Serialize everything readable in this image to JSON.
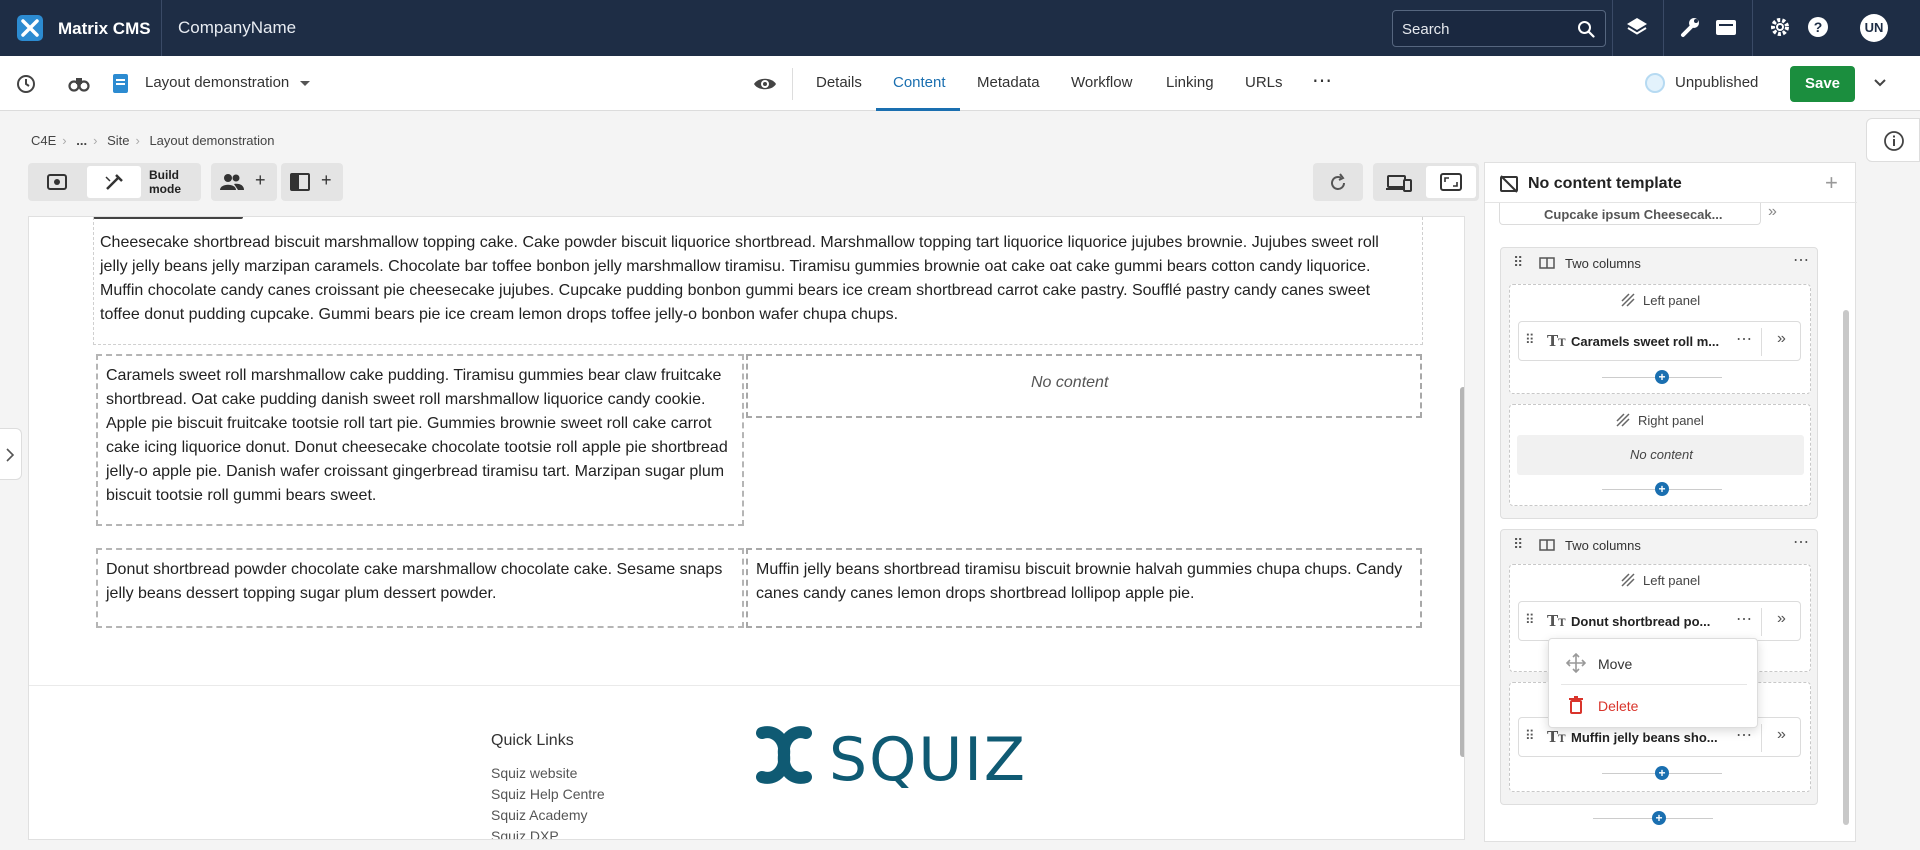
{
  "header": {
    "app_name": "Matrix CMS",
    "company": "CompanyName",
    "search_placeholder": "Search",
    "avatar": "UN"
  },
  "toolbar": {
    "asset_name": "Layout demonstration",
    "tabs": [
      "Details",
      "Content",
      "Metadata",
      "Workflow",
      "Linking",
      "URLs"
    ],
    "active_tab": "Content",
    "status": "Unpublished",
    "save_label": "Save"
  },
  "breadcrumb": [
    "C4E",
    "...",
    "Site",
    "Layout demonstration"
  ],
  "mode": {
    "label": "Build mode"
  },
  "content": {
    "intro": "Cheesecake shortbread biscuit marshmallow topping cake. Cake powder biscuit liquorice shortbread. Marshmallow topping tart liquorice liquorice jujubes brownie. Jujubes sweet roll jelly jelly beans jelly marzipan caramels. Chocolate bar toffee bonbon jelly marshmallow tiramisu. Tiramisu gummies brownie oat cake oat cake gummi bears cotton candy liquorice. Muffin chocolate candy canes croissant pie cheesecake jujubes. Cupcake pudding bonbon gummi bears ice cream shortbread carrot cake pastry. Soufflé pastry candy canes sweet toffee donut pudding cupcake. Gummi bears pie ice cream lemon drops toffee jelly-o bonbon wafer chupa chups.",
    "row1_left": "Caramels sweet roll marshmallow cake pudding. Tiramisu gummies bear claw fruitcake shortbread. Oat cake pudding danish sweet roll marshmallow liquorice candy cookie. Apple pie biscuit fruitcake tootsie roll tart pie. Gummies brownie sweet roll cake carrot cake icing liquorice donut. Donut cheesecake chocolate tootsie roll apple pie shortbread jelly-o apple pie. Danish wafer croissant gingerbread tiramisu tart. Marzipan sugar plum biscuit tootsie roll gummi bears sweet.",
    "row1_right": "No content",
    "row2_left": "Donut shortbread powder chocolate cake marshmallow chocolate cake. Sesame snaps jelly beans dessert topping sugar plum dessert powder.",
    "row2_right": "Muffin jelly beans shortbread tiramisu biscuit brownie halvah gummies chupa chups. Candy canes candy canes lemon drops shortbread lollipop apple pie."
  },
  "footer": {
    "quick_links_title": "Quick Links",
    "links": [
      "Squiz website",
      "Squiz Help Centre",
      "Squiz Academy",
      "Squiz DXP"
    ],
    "logo_text": "SQUIZ"
  },
  "panel": {
    "title": "No content template",
    "top_item": "Cupcake ipsum Cheesecak...",
    "comp1": {
      "title": "Two columns",
      "left_label": "Left panel",
      "left_item": "Caramels sweet roll m...",
      "right_label": "Right panel",
      "right_empty": "No content"
    },
    "comp2": {
      "title": "Two columns",
      "left_label": "Left panel",
      "left_item": "Donut shortbread po...",
      "right_item": "Muffin jelly beans sho..."
    }
  },
  "context_menu": {
    "move": "Move",
    "delete": "Delete"
  },
  "colors": {
    "topbar": "#1e2d45",
    "accent": "#1a6fb0",
    "save": "#1b8e3e",
    "delete": "#d9342b"
  }
}
